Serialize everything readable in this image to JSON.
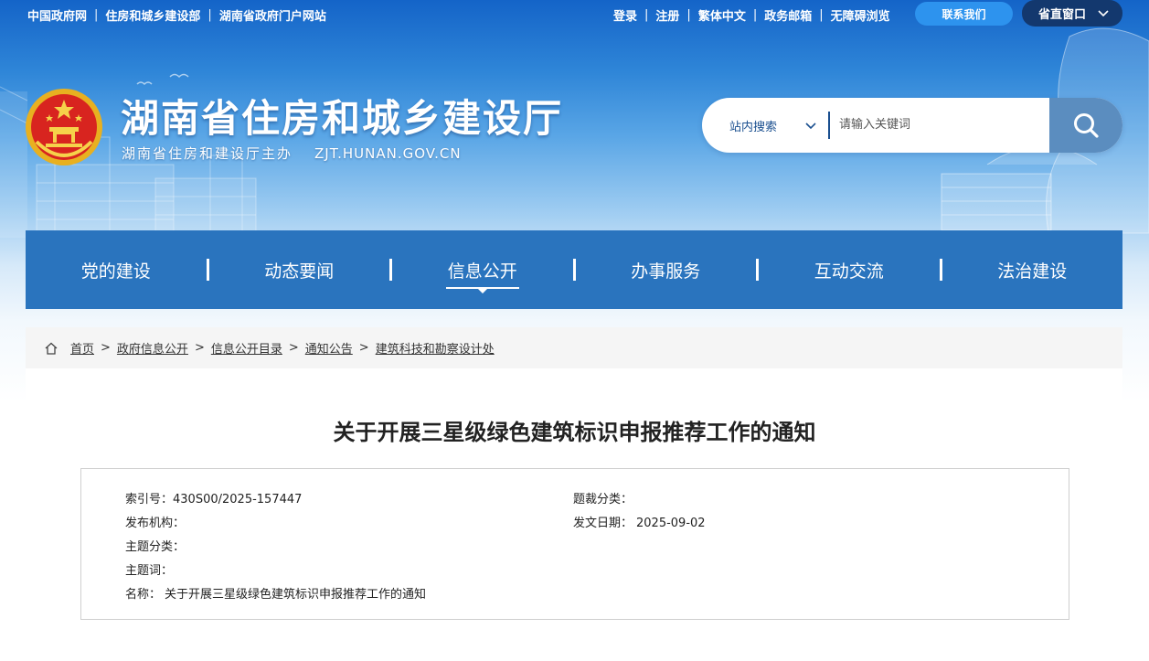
{
  "top_links_left": [
    "中国政府网",
    "住房和城乡建设部",
    "湖南省政府门户网站"
  ],
  "top_links_right": [
    "登录",
    "注册",
    "繁体中文",
    "政务邮箱",
    "无障碍浏览"
  ],
  "contact_button": "联系我们",
  "province_button": "省直窗口",
  "site": {
    "title": "湖南省住房和城乡建设厅",
    "subtitle": "湖南省住房和建设厅主办",
    "domain": "ZJT.HUNAN.GOV.CN"
  },
  "search": {
    "scope": "站内搜索",
    "placeholder": "请输入关键词"
  },
  "nav": [
    {
      "label": "党的建设"
    },
    {
      "label": "动态要闻"
    },
    {
      "label": "信息公开"
    },
    {
      "label": "办事服务"
    },
    {
      "label": "互动交流"
    },
    {
      "label": "法治建设"
    }
  ],
  "nav_active": "信息公开",
  "breadcrumb": [
    "首页",
    "政府信息公开",
    "信息公开目录",
    "通知公告",
    "建筑科技和勘察设计处"
  ],
  "article": {
    "title": "关于开展三星级绿色建筑标识申报推荐工作的通知",
    "meta": {
      "index_label": "索引号：",
      "index_value": "430S00/2025-157447",
      "genre_label": "题裁分类：",
      "genre_value": "",
      "publisher_label": "发布机构：",
      "publisher_value": "",
      "date_label": "发文日期：",
      "date_value": "2025-09-02",
      "topic_label": "主题分类：",
      "topic_value": "",
      "keywords_label": "主题词：",
      "keywords_value": "",
      "name_label": "名称：",
      "name_value": "关于开展三星级绿色建筑标识申报推荐工作的通知"
    }
  },
  "colors": {
    "nav_bg": "#2a74be",
    "header_top": "#1464c8",
    "contact_btn": "#2d93ee",
    "province_btn": "#13386e",
    "search_btn": "#5b8dbf"
  },
  "icons": [
    "emblem-icon",
    "chevron-down-icon",
    "search-icon",
    "home-icon"
  ]
}
